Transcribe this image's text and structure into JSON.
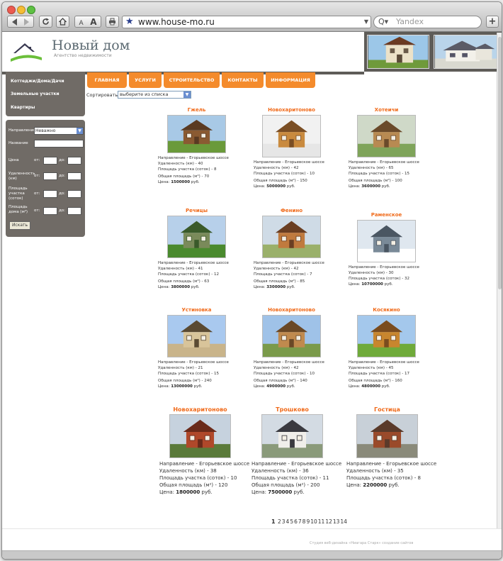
{
  "browser": {
    "url": "www.house-mo.ru",
    "search_placeholder": "Yandex",
    "search_icon": "Q▾",
    "font_small": "A",
    "font_large": "A"
  },
  "site": {
    "title": "Новый дом",
    "subtitle": "Агентство недвижимости"
  },
  "sidebar": {
    "links": [
      "Коттеджи/Дома/Дачи",
      "Земельные участки",
      "Квартиры"
    ],
    "filter": {
      "direction_label": "Направление",
      "direction_value": "Неважно",
      "name_label": "Название",
      "price_label": "Цена",
      "distance_label": "Удаленность (км)",
      "plot_label": "Площадь участка (соток)",
      "house_area_label": "Площадь дома (м²)",
      "from": "от:",
      "to": "до:",
      "search_button": "Искать"
    }
  },
  "nav": [
    "ГЛАВНАЯ",
    "УСЛУГИ",
    "СТРОИТЕЛЬСТВО",
    "КОНТАКТЫ",
    "ИНФОРМАЦИЯ"
  ],
  "sort": {
    "label": "Сортировать",
    "value": "выберите из списка"
  },
  "labels": {
    "direction": "Направление - Егорьевское шоссе",
    "distance": "Удаленность (км) - ",
    "plot": "Площадь участка (соток) - ",
    "area": "Общая площадь (м²) - ",
    "price": "Цена: ",
    "currency": " руб."
  },
  "listings": [
    {
      "title": "Гжель",
      "distance": "40",
      "plot": "8",
      "area": "70",
      "price": "1500000"
    },
    {
      "title": "Новохаритоново",
      "distance": "42",
      "plot": "10",
      "area": "150",
      "price": "5000000"
    },
    {
      "title": "Хотеичи",
      "distance": "65",
      "plot": "15",
      "area": "100",
      "price": "3600000"
    },
    {
      "title": "Речицы",
      "distance": "41",
      "plot": "12",
      "area": "63",
      "price": "3800000"
    },
    {
      "title": "Фенино",
      "distance": "42",
      "plot": "7",
      "area": "85",
      "price": "3300000"
    },
    {
      "title": "Раменское",
      "distance": "30",
      "plot": "32",
      "area": "",
      "price": "10700000"
    },
    {
      "title": "Устиновка",
      "distance": "21",
      "plot": "15",
      "area": "240",
      "price": "13000000"
    },
    {
      "title": "Новохаритоново",
      "distance": "42",
      "plot": "10",
      "area": "140",
      "price": "4900000"
    },
    {
      "title": "Косякино",
      "distance": "45",
      "plot": "17",
      "area": "160",
      "price": "4800000"
    },
    {
      "title": "Новохаритоново",
      "distance": "38",
      "plot": "10",
      "area": "120",
      "price": "1800000"
    },
    {
      "title": "Трошково",
      "distance": "36",
      "plot": "11",
      "area": "200",
      "price": "7500000"
    },
    {
      "title": "Гостица",
      "distance": "35",
      "plot": "8",
      "area": "",
      "price": "2200000"
    }
  ],
  "pagination": {
    "current": "1",
    "pages": [
      "2",
      "3",
      "4",
      "5",
      "6",
      "7",
      "8",
      "9",
      "10",
      "11",
      "12",
      "13",
      "14"
    ]
  },
  "footer": {
    "credit": "Студия веб-дизайна «Ниагара Старк» создание сайтов"
  },
  "colors": {
    "accent": "#f48b2c",
    "listing_title": "#f06a1a",
    "sidebar": "#706b66"
  }
}
